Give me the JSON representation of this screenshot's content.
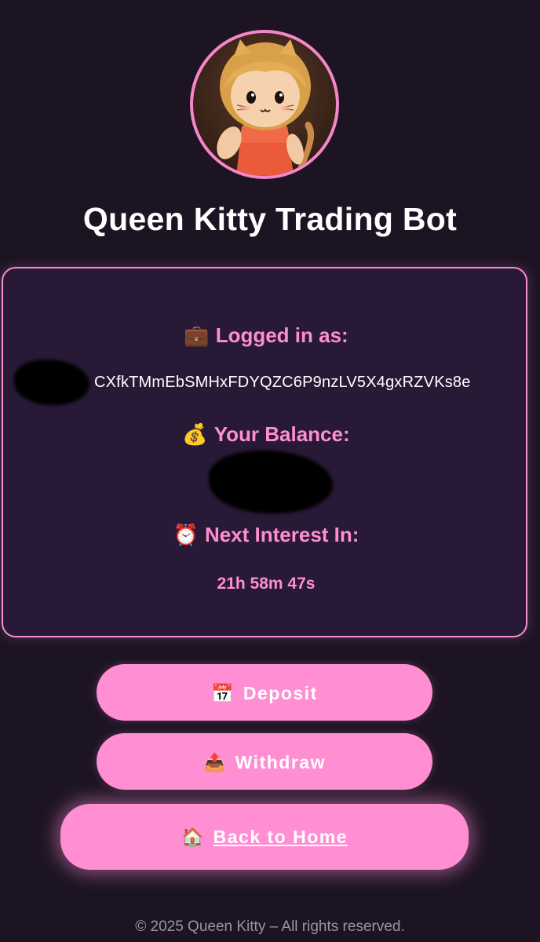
{
  "app": {
    "title": "Queen Kitty Trading Bot",
    "avatar_icon": "queen-kitty-avatar"
  },
  "account": {
    "logged_in_icon": "💼",
    "logged_in_label": "Logged in as:",
    "address_visible": "CXfkTMmEbSMHxFDYQZC6P9nzLV5X4gxRZVKs8e",
    "balance_icon": "💰",
    "balance_label": "Your Balance:",
    "interest_icon": "⏰",
    "interest_label": "Next Interest In:",
    "countdown": "21h 58m 47s"
  },
  "actions": {
    "deposit_icon": "📅",
    "deposit_label": "Deposit",
    "withdraw_icon": "📤",
    "withdraw_label": "Withdraw",
    "home_icon": "🏠",
    "home_label": "Back to Home"
  },
  "footer": {
    "copyright": "© 2025 Queen Kitty – All rights reserved."
  },
  "colors": {
    "background": "#1d1423",
    "card": "#281a37",
    "accent": "#ff8ed3",
    "border": "#f48fd0"
  }
}
